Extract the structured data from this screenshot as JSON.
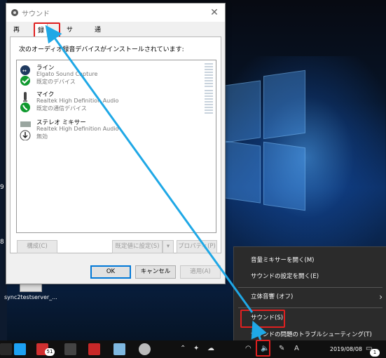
{
  "dialog": {
    "title": "サウンド",
    "tabs": [
      "再生",
      "録音",
      "サウンド",
      "通信"
    ],
    "active_tab": "録音",
    "description": "次のオーディオ録音デバイスがインストールされています:",
    "devices": [
      {
        "name": "ライン",
        "driver": "Elgato Sound Capture",
        "status": "既定のデバイス",
        "icon": "line-in-icon"
      },
      {
        "name": "マイク",
        "driver": "Realtek High Definition Audio",
        "status": "既定の通信デバイス",
        "icon": "microphone-icon"
      },
      {
        "name": "ステレオ ミキサー",
        "driver": "Realtek High Definition Audio",
        "status": "無効",
        "icon": "stereo-mixer-icon"
      }
    ],
    "buttons": {
      "configure": "構成(C)",
      "set_default": "既定値に設定(S)",
      "properties": "プロパティ(P)",
      "ok": "OK",
      "cancel": "キャンセル",
      "apply": "適用(A)"
    }
  },
  "context_menu": {
    "items": [
      "音量ミキサーを開く(M)",
      "サウンドの設定を開く(E)",
      "立体音響 (オフ)",
      "サウンド(S)",
      "サウンドの問題のトラブルシューティング(T)"
    ]
  },
  "desktop": {
    "icon_label": "sync2testserver_...",
    "left_edge_labels": [
      "9",
      "8"
    ]
  },
  "taskbar": {
    "app_badge": "51",
    "tray_a": "A",
    "date": "2019/08/08",
    "notification_count": "1"
  },
  "colors": {
    "highlight": "#e02020",
    "arrow": "#1fa8e6",
    "accent": "#0078d7"
  }
}
